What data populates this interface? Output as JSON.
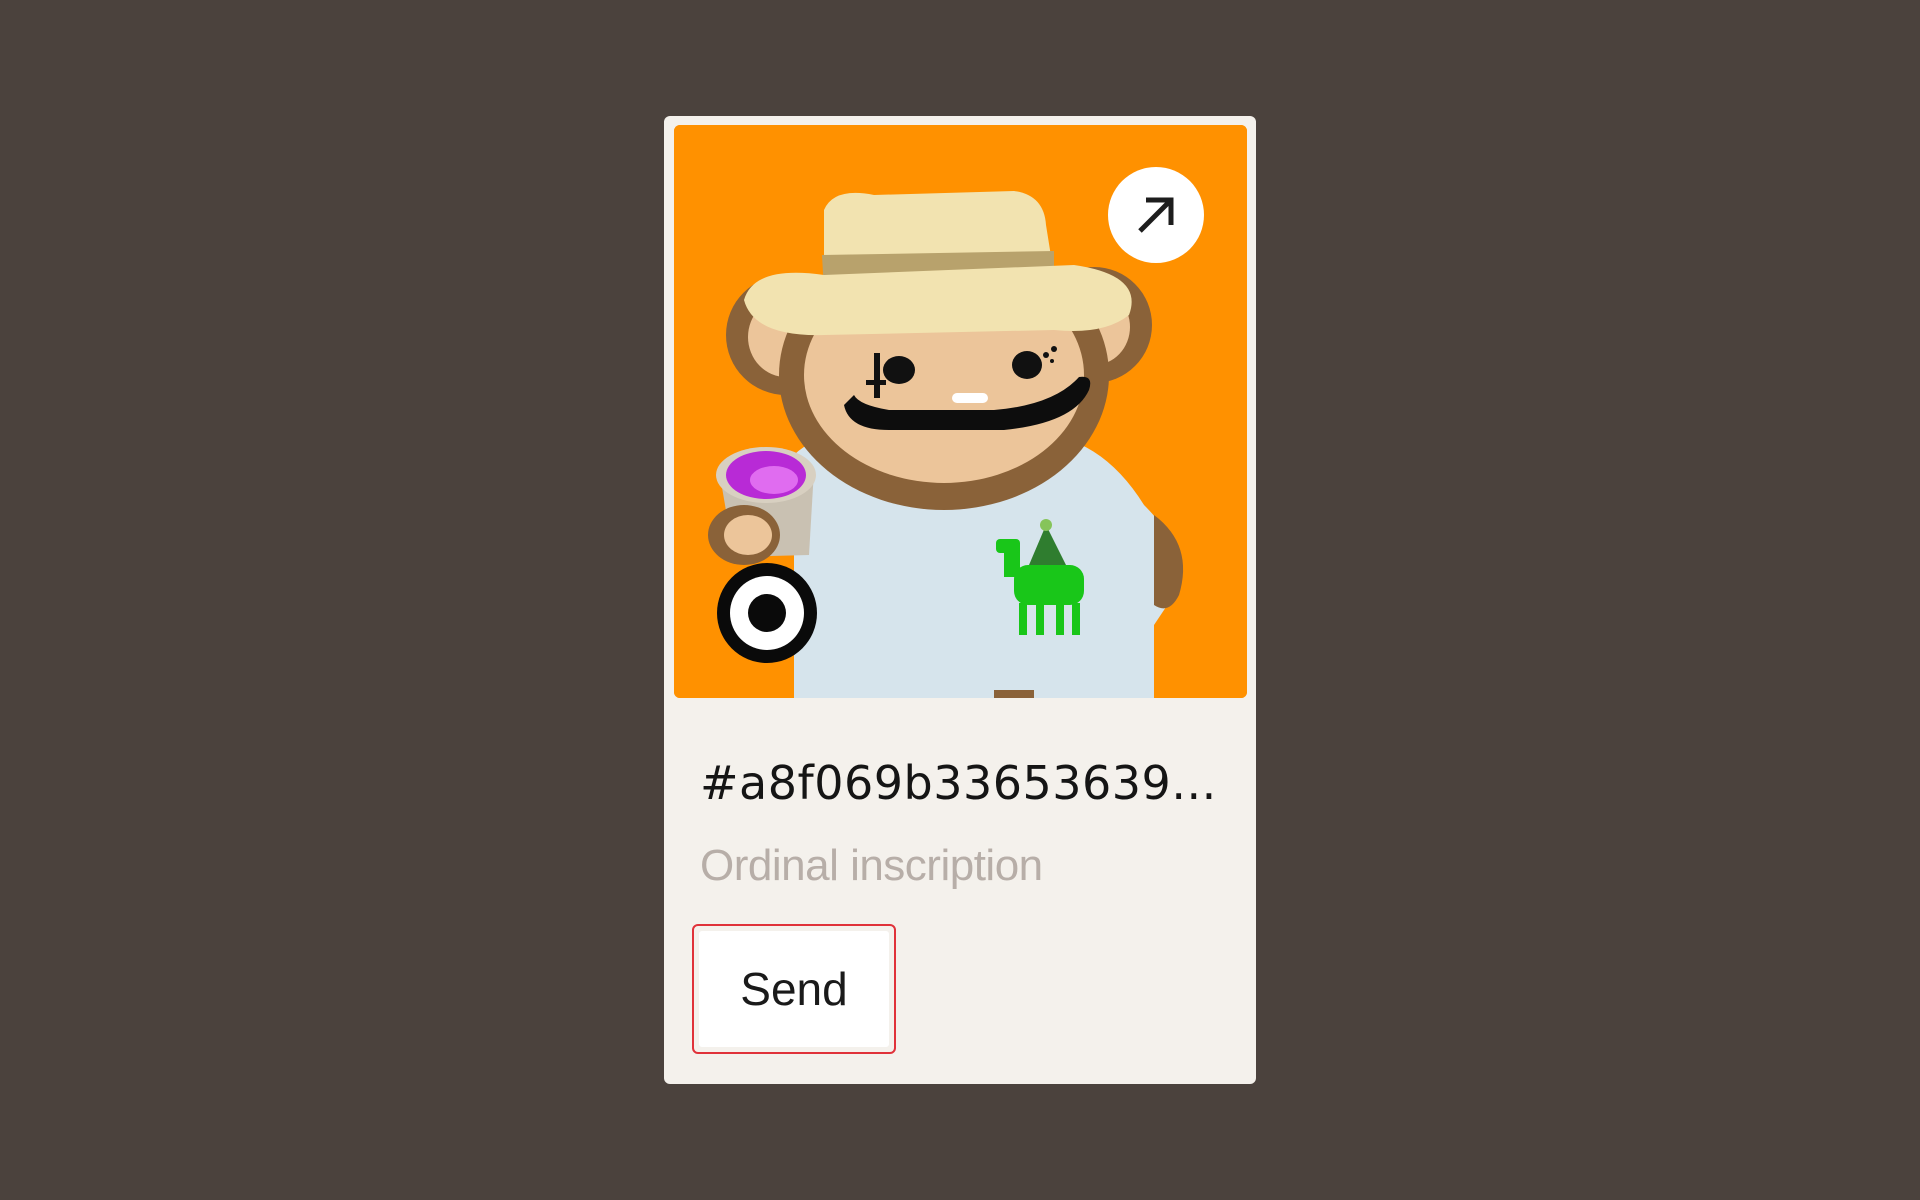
{
  "card": {
    "inscription_id": "#a8f069b33653639...",
    "inscription_type": "Ordinal inscription",
    "send_label": "Send"
  },
  "image": {
    "background_color": "#ff9100",
    "subject": "pixel-art monkey in straw hat holding purple drink cup, t-shirt with green camel"
  },
  "icons": {
    "open_external": "arrow-up-right-icon",
    "ordinal_badge": "ordinals-logo-icon"
  },
  "colors": {
    "page_background": "#4b423d",
    "card_background": "#f4f1ec",
    "send_focus_border": "#e0323a",
    "secondary_text": "#b7aea8"
  }
}
